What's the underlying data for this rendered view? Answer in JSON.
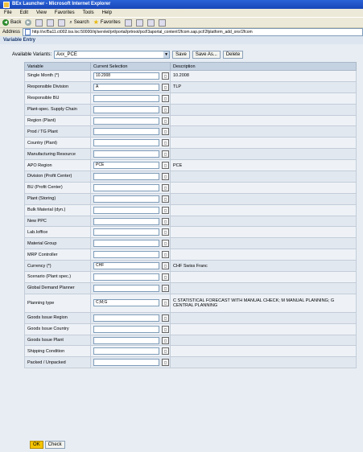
{
  "window": {
    "title": "BEx Launcher - Microsoft Internet Explorer"
  },
  "menu": [
    "File",
    "Edit",
    "View",
    "Favorites",
    "Tools",
    "Help"
  ],
  "toolbar": {
    "back": "Back",
    "search": "Search",
    "favorites": "Favorites"
  },
  "address": {
    "label": "Address",
    "url": "http://vcf5a11.ct002.tss.loc:50000/irj/servlet/prt/portal/prtroot/pcd!3aportal_content!2fcom.sap.pct!2fplatform_add_ons!2fcom"
  },
  "page": {
    "title": "Variable Entry"
  },
  "variants": {
    "label": "Available Variants:",
    "value": "Axx_PCE",
    "save": "Save",
    "save_as": "Save As...",
    "delete": "Delete"
  },
  "table": {
    "headers": [
      "Variable",
      "Current Selection",
      "Description"
    ],
    "rows": [
      {
        "variable": "Single Month (*)",
        "selection": "10.2008",
        "description": "10.2008"
      },
      {
        "variable": "Responsible Division",
        "selection": "A",
        "description": "TLP"
      },
      {
        "variable": "Responsible BU",
        "selection": "",
        "description": ""
      },
      {
        "variable": "Plant-spec. Supply Chain",
        "selection": "",
        "description": ""
      },
      {
        "variable": "Region (Plant)",
        "selection": "",
        "description": ""
      },
      {
        "variable": "Prod / TG Plant",
        "selection": "",
        "description": ""
      },
      {
        "variable": "Country (Plant)",
        "selection": "",
        "description": ""
      },
      {
        "variable": "Manufacturing Resource",
        "selection": "",
        "description": ""
      },
      {
        "variable": "APO Region",
        "selection": "PCE",
        "description": "PCE"
      },
      {
        "variable": "Division (Profit Center)",
        "selection": "",
        "description": ""
      },
      {
        "variable": "BU (Profit Center)",
        "selection": "",
        "description": ""
      },
      {
        "variable": "Plant (Storing)",
        "selection": "",
        "description": ""
      },
      {
        "variable": "Bulk Material (dyn.)",
        "selection": "",
        "description": ""
      },
      {
        "variable": "New PPC",
        "selection": "",
        "description": ""
      },
      {
        "variable": "Lab.Ioffice",
        "selection": "",
        "description": ""
      },
      {
        "variable": "Material Group",
        "selection": "",
        "description": ""
      },
      {
        "variable": "MRP Controller",
        "selection": "",
        "description": ""
      },
      {
        "variable": "Currency (*)",
        "selection": "CHF",
        "description": "CHF Swiss Franc"
      },
      {
        "variable": "Scenario (Plant spec.)",
        "selection": "",
        "description": ""
      },
      {
        "variable": "Global Demand Planner",
        "selection": "",
        "description": ""
      },
      {
        "variable": "Planning type",
        "selection": "C;M;G",
        "description": "C STATISTICAL FORECAST WITH MANUAL CHECK; M MANUAL PLANNING; G CENTRAL PLANNING"
      },
      {
        "variable": "Goods Issue Region",
        "selection": "",
        "description": ""
      },
      {
        "variable": "Goods Issue Country",
        "selection": "",
        "description": ""
      },
      {
        "variable": "Goods Issue Plant",
        "selection": "",
        "description": ""
      },
      {
        "variable": "Shipping Condition",
        "selection": "",
        "description": ""
      },
      {
        "variable": "Packed / Unpacked",
        "selection": "",
        "description": ""
      }
    ]
  },
  "actions": {
    "ok": "OK",
    "check": "Check"
  }
}
